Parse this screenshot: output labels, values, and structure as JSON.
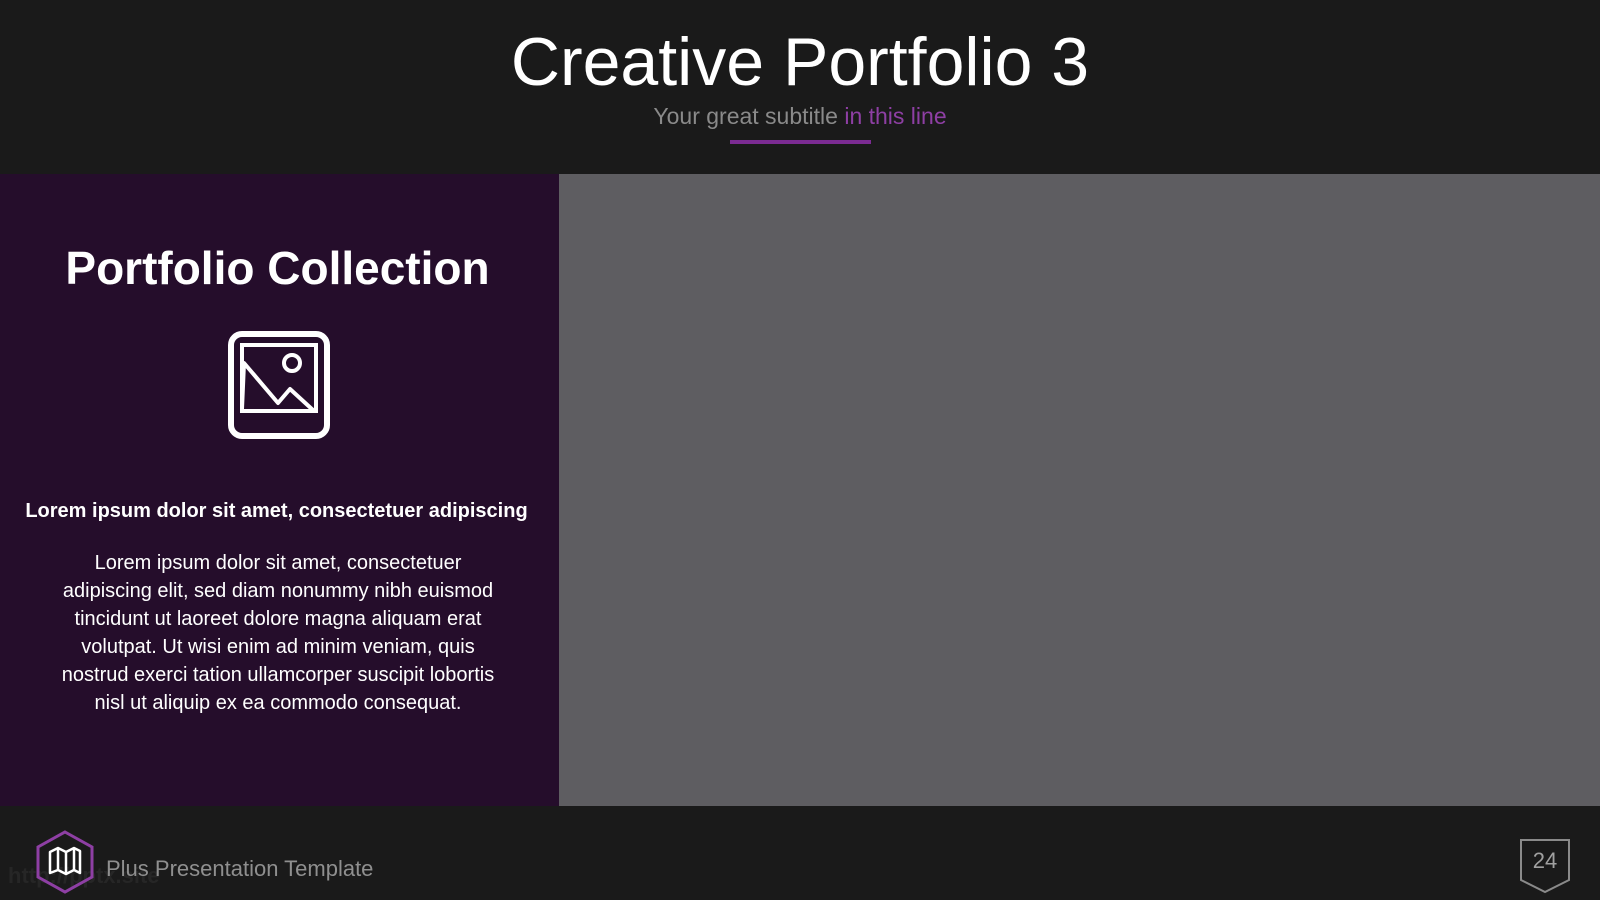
{
  "slide": {
    "title": "Creative Portfolio 3",
    "subtitle_plain": "Your great subtitle ",
    "subtitle_accent": "in this line"
  },
  "panel": {
    "heading": "Portfolio Collection",
    "icon": "image-icon",
    "lead": "Lorem ipsum dolor sit amet, consectetuer adipiscing",
    "body": "Lorem ipsum dolor sit amet, consectetuer adipiscing elit, sed diam nonummy nibh euismod tincidunt ut laoreet dolore magna aliquam erat volutpat. Ut wisi enim ad minim veniam, quis nostrud exerci tation ullamcorper suscipit lobortis nisl ut aliquip ex ea commodo consequat."
  },
  "footer": {
    "label": "Plus Presentation Template",
    "watermark": "http://pptx.site",
    "logo_icon": "map-hexagon-icon",
    "page_number": "24"
  },
  "colors": {
    "background": "#1a1a1a",
    "panel": "#250d2b",
    "accent": "#7b2b92",
    "placeholder": "#5e5d61"
  }
}
